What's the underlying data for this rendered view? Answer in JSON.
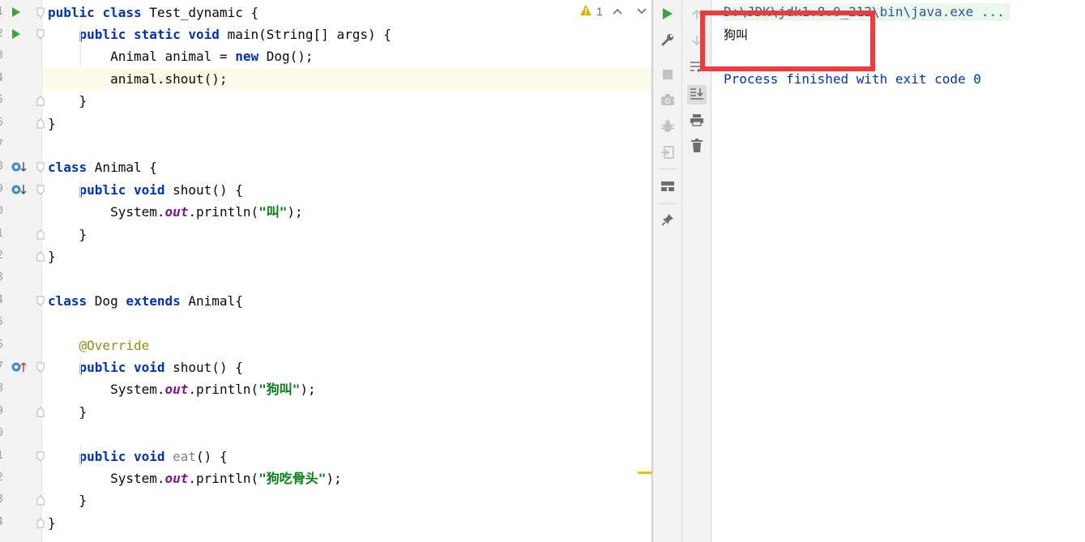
{
  "editor": {
    "line_numbers": [
      "1",
      "2",
      "3",
      "4",
      "5",
      "6",
      "7",
      "8",
      "9",
      "0",
      "1",
      "2",
      "3",
      "4",
      "5",
      "6",
      "7",
      "8",
      "9",
      "0",
      "1",
      "2",
      "3",
      "4"
    ],
    "lines": [
      [
        {
          "t": "public ",
          "c": "kw"
        },
        {
          "t": "class ",
          "c": "kw"
        },
        {
          "t": "Test_dynamic {",
          "c": ""
        }
      ],
      [
        {
          "t": "    ",
          "c": ""
        },
        {
          "t": "public ",
          "c": "kw"
        },
        {
          "t": "static ",
          "c": "kw"
        },
        {
          "t": "void ",
          "c": "kw"
        },
        {
          "t": "main(String[] args) {",
          "c": ""
        }
      ],
      [
        {
          "t": "        Animal animal = ",
          "c": ""
        },
        {
          "t": "new ",
          "c": "kw"
        },
        {
          "t": "Dog();",
          "c": ""
        }
      ],
      [
        {
          "t": "        animal.shout();",
          "c": ""
        }
      ],
      [
        {
          "t": "    }",
          "c": ""
        }
      ],
      [
        {
          "t": "}",
          "c": ""
        }
      ],
      [],
      [
        {
          "t": "class ",
          "c": "kw"
        },
        {
          "t": "Animal {",
          "c": ""
        }
      ],
      [
        {
          "t": "    ",
          "c": ""
        },
        {
          "t": "public ",
          "c": "kw"
        },
        {
          "t": "void ",
          "c": "kw"
        },
        {
          "t": "shout() {",
          "c": ""
        }
      ],
      [
        {
          "t": "        System.",
          "c": ""
        },
        {
          "t": "out",
          "c": "fld"
        },
        {
          "t": ".println(",
          "c": ""
        },
        {
          "t": "\"叫\"",
          "c": "str"
        },
        {
          "t": ");",
          "c": ""
        }
      ],
      [
        {
          "t": "    }",
          "c": ""
        }
      ],
      [
        {
          "t": "}",
          "c": ""
        }
      ],
      [],
      [
        {
          "t": "class ",
          "c": "kw"
        },
        {
          "t": "Dog ",
          "c": ""
        },
        {
          "t": "extends ",
          "c": "kw"
        },
        {
          "t": "Animal{",
          "c": ""
        }
      ],
      [],
      [
        {
          "t": "    ",
          "c": ""
        },
        {
          "t": "@Override",
          "c": "ann"
        }
      ],
      [
        {
          "t": "    ",
          "c": ""
        },
        {
          "t": "public ",
          "c": "kw"
        },
        {
          "t": "void ",
          "c": "kw"
        },
        {
          "t": "shout() {",
          "c": ""
        }
      ],
      [
        {
          "t": "        System.",
          "c": ""
        },
        {
          "t": "out",
          "c": "fld"
        },
        {
          "t": ".println(",
          "c": ""
        },
        {
          "t": "\"狗叫\"",
          "c": "str"
        },
        {
          "t": ");",
          "c": ""
        }
      ],
      [
        {
          "t": "    }",
          "c": ""
        }
      ],
      [],
      [
        {
          "t": "    ",
          "c": ""
        },
        {
          "t": "public ",
          "c": "kw"
        },
        {
          "t": "void ",
          "c": "kw"
        },
        {
          "t": "eat",
          "c": "unused"
        },
        {
          "t": "() {",
          "c": ""
        }
      ],
      [
        {
          "t": "        System.",
          "c": ""
        },
        {
          "t": "out",
          "c": "fld"
        },
        {
          "t": ".println(",
          "c": ""
        },
        {
          "t": "\"狗吃骨头\"",
          "c": "str"
        },
        {
          "t": ");",
          "c": ""
        }
      ],
      [
        {
          "t": "    }",
          "c": ""
        }
      ],
      [
        {
          "t": "}",
          "c": ""
        }
      ]
    ],
    "inspection_warning_count": "1",
    "highlighted_line": 4
  },
  "run_toolbar": {
    "primary": [
      "run-icon",
      "wrench-icon",
      "stop-icon",
      "camera-icon",
      "debug-bug-icon",
      "login-icon",
      "layout-icon",
      "pin-icon"
    ],
    "secondary": [
      "up-arrow-icon",
      "down-arrow-icon",
      "soft-wrap-icon",
      "scroll-to-end-icon",
      "print-icon",
      "trash-icon"
    ]
  },
  "console": {
    "command": "D:\\JDK\\jdk1.8.0_212\\bin\\java.exe ...",
    "output": "狗叫",
    "exit_message": "Process finished with exit code 0"
  },
  "colors": {
    "keyword": "#0033b3",
    "string": "#067d17",
    "field": "#871094",
    "annotation": "#9e880d",
    "highlight_box": "#ef3b3b",
    "run_green": "#3aa63a"
  }
}
